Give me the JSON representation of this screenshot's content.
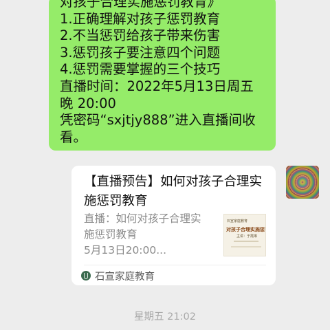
{
  "message": {
    "lines": [
      "对孩子合理实施惩罚教育》",
      "1.正确理解对孩子惩罚教育",
      "2.不当惩罚给孩子带来伤害",
      "3.惩罚孩子要注意四个问题",
      "4.惩罚需要掌握的三个技巧",
      "直播时间：2022年5月13日周五",
      "晚 20:00",
      "凭密码“sxjtjy888”进入直播间收",
      "看。"
    ]
  },
  "card": {
    "title": "【直播预告】如何对孩子合理实施惩罚教育",
    "desc_line1": "直播：如何对孩子合理实",
    "desc_line2": "施惩罚教育",
    "desc_line3": "5月13日20:00...",
    "thumbnail": {
      "top_text": "石宣家庭教育",
      "main_text": "对孩子合理实施惩罚",
      "sub_text": "主讲：于霞琳"
    },
    "source_name": "石宣家庭教育",
    "source_icon": "official-account-icon"
  },
  "timestamp": "星期五 21:02",
  "colors": {
    "bubble": "#95ec69",
    "background": "#ededed",
    "card": "#ffffff"
  }
}
